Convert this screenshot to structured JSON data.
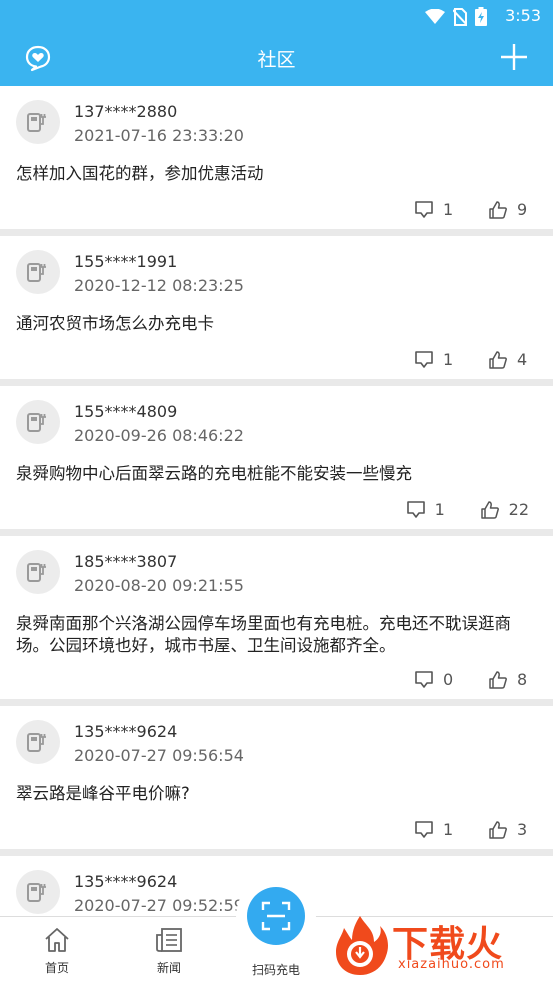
{
  "status_bar": {
    "time": "3:53"
  },
  "header": {
    "title": "社区"
  },
  "posts": [
    {
      "user": "137****2880",
      "time": "2021-07-16 23:33:20",
      "content": "怎样加入国花的群，参加优惠活动",
      "comments": "1",
      "likes": "9"
    },
    {
      "user": "155****1991",
      "time": "2020-12-12 08:23:25",
      "content": "通河农贸市场怎么办充电卡",
      "comments": "1",
      "likes": "4"
    },
    {
      "user": "155****4809",
      "time": "2020-09-26 08:46:22",
      "content": "泉舜购物中心后面翠云路的充电桩能不能安装一些慢充",
      "comments": "1",
      "likes": "22"
    },
    {
      "user": "185****3807",
      "time": "2020-08-20 09:21:55",
      "content": "泉舜南面那个兴洛湖公园停车场里面也有充电桩。充电还不耽误逛商场。公园环境也好，城市书屋、卫生间设施都齐全。",
      "comments": "0",
      "likes": "8"
    },
    {
      "user": "135****9624",
      "time": "2020-07-27 09:56:54",
      "content": "翠云路是峰谷平电价嘛?",
      "comments": "1",
      "likes": "3"
    },
    {
      "user": "135****9624",
      "time": "2020-07-27 09:52:59",
      "content": "",
      "comments": "",
      "likes": ""
    }
  ],
  "bottom_nav": {
    "home": "首页",
    "news": "新闻",
    "scan": "扫码充电"
  },
  "watermark": {
    "cn": "下载火",
    "en": "xiazaihuo.com"
  },
  "colors": {
    "accent": "#3ab4f0",
    "watermark": "#f04a1c"
  }
}
